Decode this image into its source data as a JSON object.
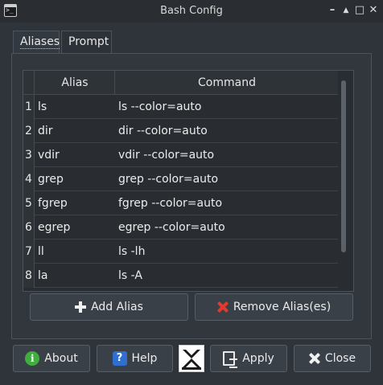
{
  "window": {
    "title": "Bash Config",
    "controls": {
      "minimize": "–",
      "restore": "▲",
      "maximize": "□",
      "close": "✕"
    }
  },
  "tabs": [
    {
      "label": "Aliases",
      "active": true
    },
    {
      "label": "Prompt",
      "active": false
    }
  ],
  "table": {
    "headers": {
      "alias": "Alias",
      "command": "Command"
    },
    "rows": [
      {
        "num": "1",
        "alias": "ls",
        "command": "ls --color=auto"
      },
      {
        "num": "2",
        "alias": "dir",
        "command": "dir --color=auto"
      },
      {
        "num": "3",
        "alias": "vdir",
        "command": "vdir --color=auto"
      },
      {
        "num": "4",
        "alias": "grep",
        "command": "grep --color=auto"
      },
      {
        "num": "5",
        "alias": "fgrep",
        "command": "fgrep --color=auto"
      },
      {
        "num": "6",
        "alias": "egrep",
        "command": "egrep --color=auto"
      },
      {
        "num": "7",
        "alias": "ll",
        "command": "ls -lh"
      },
      {
        "num": "8",
        "alias": "la",
        "command": "ls -A"
      }
    ]
  },
  "panel_buttons": {
    "add": "Add Alias",
    "remove": "Remove Alias(es)"
  },
  "footer_buttons": {
    "about": "About",
    "help": "Help",
    "apply": "Apply",
    "close": "Close"
  },
  "icons": {
    "about_glyph": "i",
    "help_glyph": "?"
  },
  "colors": {
    "background": "#2f343a",
    "remove_icon": "#e23b2e",
    "about_icon": "#3fae3f",
    "help_icon": "#2f6fd0"
  }
}
